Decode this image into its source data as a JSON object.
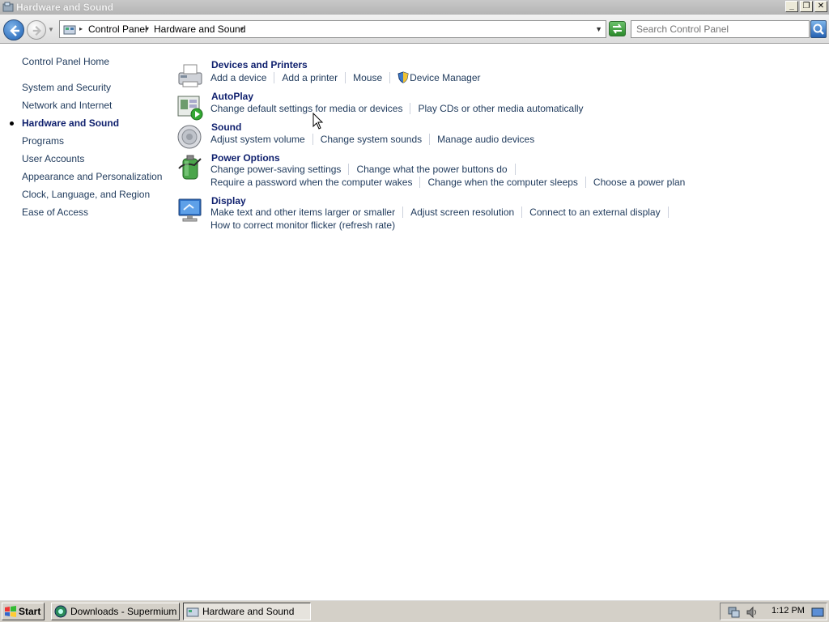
{
  "window": {
    "title": "Hardware and Sound",
    "buttons": [
      "_",
      "❐",
      "✕"
    ]
  },
  "address": {
    "crumbs": [
      "Control Panel",
      "Hardware and Sound"
    ],
    "search_placeholder": "Search Control Panel"
  },
  "sidebar": {
    "home": "Control Panel Home",
    "items": [
      "System and Security",
      "Network and Internet",
      "Hardware and Sound",
      "Programs",
      "User Accounts",
      "Appearance and Personalization",
      "Clock, Language, and Region",
      "Ease of Access"
    ],
    "active_index": 2
  },
  "categories": {
    "devices": {
      "title": "Devices and Printers",
      "links": [
        "Add a device",
        "Add a printer",
        "Mouse",
        "Device Manager"
      ]
    },
    "autoplay": {
      "title": "AutoPlay",
      "links": [
        "Change default settings for media or devices",
        "Play CDs or other media automatically"
      ]
    },
    "sound": {
      "title": "Sound",
      "links": [
        "Adjust system volume",
        "Change system sounds",
        "Manage audio devices"
      ]
    },
    "power": {
      "title": "Power Options",
      "links": [
        "Change power-saving settings",
        "Change what the power buttons do",
        "Require a password when the computer wakes",
        "Change when the computer sleeps",
        "Choose a power plan"
      ]
    },
    "display": {
      "title": "Display",
      "links": [
        "Make text and other items larger or smaller",
        "Adjust screen resolution",
        "Connect to an external display",
        "How to correct monitor flicker (refresh rate)"
      ]
    }
  },
  "taskbar": {
    "start": "Start",
    "tasks": [
      "Downloads - Supermium",
      "Hardware and Sound"
    ],
    "clock": "1:12 PM"
  },
  "colors": {
    "link": "#1e395b",
    "title": "#0e1f6d",
    "taskbar": "#d4d0c8"
  }
}
